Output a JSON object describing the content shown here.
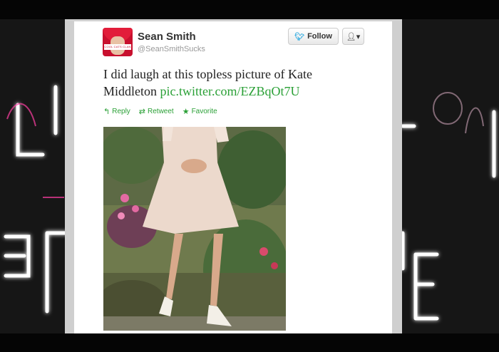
{
  "tweet": {
    "author_name": "Sean Smith",
    "author_handle": "@SeanSmithSucks",
    "avatar_caption": "COOL CATS CLAN",
    "text": "I did laugh at this topless picture of Kate Middleton ",
    "link_text": "pic.twitter.com/EZBqOt7U"
  },
  "buttons": {
    "follow_label": "Follow",
    "user_menu_icon": "user-caret-icon"
  },
  "actions": [
    {
      "label": "Reply",
      "icon": "reply-icon"
    },
    {
      "label": "Retweet",
      "icon": "retweet-icon"
    },
    {
      "label": "Favorite",
      "icon": "star-icon"
    }
  ],
  "colors": {
    "link": "#2aa036",
    "follow_bird": "#2aa9e0",
    "neon": "#ff3fa3"
  }
}
